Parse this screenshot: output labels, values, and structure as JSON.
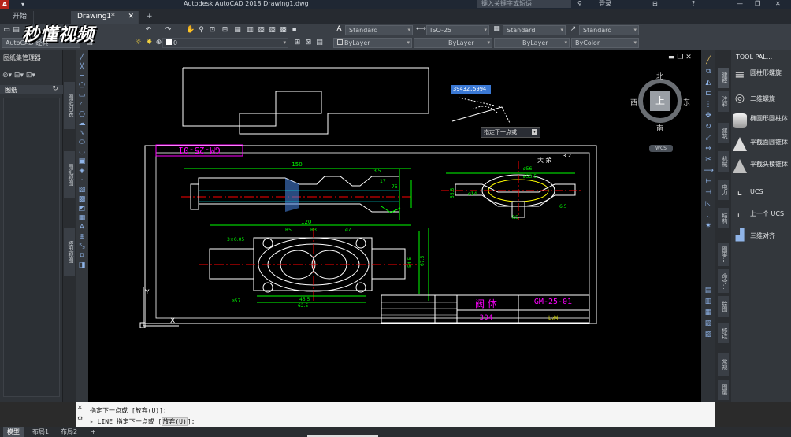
{
  "app": {
    "title": "Autodesk AutoCAD 2018  Drawing1.dwg",
    "search_placeholder": "键入关键字或短语",
    "signin": "登录"
  },
  "tabs": [
    {
      "label": "开始"
    },
    {
      "label": "Drawing1*"
    },
    {
      "label": "+"
    }
  ],
  "watermark": "秒懂视频",
  "toolbar": {
    "workspace": "AutoCAD 经典",
    "layer_value": "0",
    "style_combos": [
      "Standard",
      "ISO-25",
      "Standard",
      "Standard"
    ],
    "prop_combos": [
      "ByLayer",
      "ByLayer",
      "ByLayer",
      "ByColor"
    ]
  },
  "left_panel": {
    "title": "图纸集管理器",
    "section": "图纸",
    "vtabs": [
      "图纸列表",
      "图纸视图",
      "模型视图"
    ]
  },
  "canvas": {
    "input_value": "39432.5994",
    "tooltip": "指定下一点或",
    "viewcube": {
      "north": "北",
      "south": "南",
      "east": "东",
      "west": "西",
      "top": "上",
      "ucs": "WCS"
    },
    "drawing": {
      "part_no": "GM-25-01",
      "title_cn": "阀 体",
      "material": "304",
      "scale": "比例",
      "label_top": "大 余",
      "roughness": "3.2",
      "dims": [
        "150",
        "120",
        "R5",
        "R3",
        "3×0.05",
        "ø7",
        "45.5",
        "62.5",
        "ø57",
        "54.5",
        "67.5",
        "ø56",
        "ø53.5",
        "ø14",
        "55.5",
        "R5",
        "6.5",
        "75",
        "17",
        "3.5"
      ]
    }
  },
  "palette": {
    "title": "TOOL PAL...",
    "items": [
      "圆柱形螺旋",
      "二维螺旋",
      "椭圆形圆柱体",
      "平截面圆锥体",
      "平截头棱锥体",
      "UCS",
      "上一个 UCS",
      "三维对齐"
    ],
    "vtabs": [
      "建模",
      "注释",
      "建筑",
      "机械",
      "电力",
      "结构",
      "图案...",
      "命令...",
      "绘图",
      "修改",
      "常规",
      "图层"
    ]
  },
  "command": {
    "history": "指定下一点或 [放弃(U)]:",
    "prompt_prefix": "LINE 指定下一点或 [",
    "prompt_option": "放弃(U)",
    "prompt_suffix": "]:"
  },
  "layout_tabs": [
    "模型",
    "布局1",
    "布局2",
    "+"
  ],
  "colors": {
    "canvas_bg": "#000000",
    "accent": "#3a78d4"
  }
}
